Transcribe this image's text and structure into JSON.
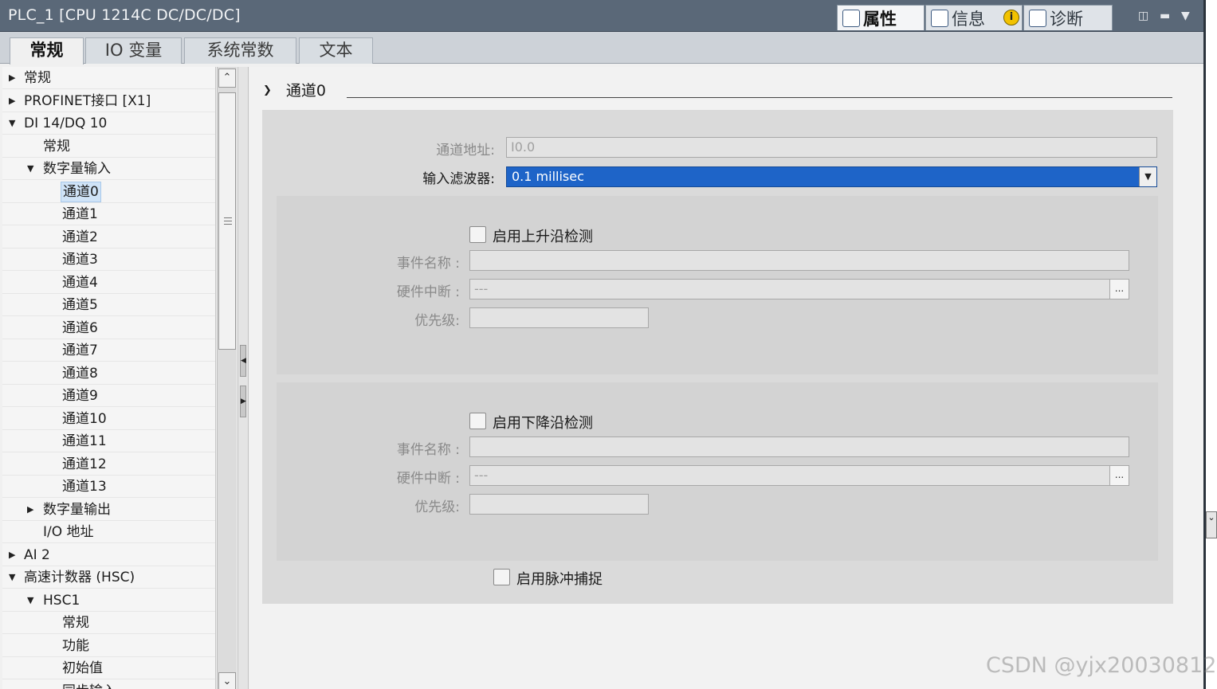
{
  "window": {
    "title": "PLC_1 [CPU 1214C DC/DC/DC]"
  },
  "inspector_tabs": [
    {
      "label": "属性",
      "icon": "properties-icon",
      "active": true
    },
    {
      "label": "信息",
      "icon": "info-icon",
      "badge": "i"
    },
    {
      "label": "诊断",
      "icon": "diagnostics-icon"
    }
  ],
  "subtabs": [
    "常规",
    "IO 变量",
    "系统常数",
    "文本"
  ],
  "tree": [
    {
      "label": "常规",
      "level": 0,
      "expander": "collapsed"
    },
    {
      "label": "PROFINET接口 [X1]",
      "level": 0,
      "expander": "collapsed"
    },
    {
      "label": "DI 14/DQ 10",
      "level": 0,
      "expander": "expanded"
    },
    {
      "label": "常规",
      "level": 1,
      "expander": "none"
    },
    {
      "label": "数字量输入",
      "level": 1,
      "expander": "expanded"
    },
    {
      "label": "通道0",
      "level": 2,
      "expander": "none",
      "selected": true
    },
    {
      "label": "通道1",
      "level": 2,
      "expander": "none"
    },
    {
      "label": "通道2",
      "level": 2,
      "expander": "none"
    },
    {
      "label": "通道3",
      "level": 2,
      "expander": "none"
    },
    {
      "label": "通道4",
      "level": 2,
      "expander": "none"
    },
    {
      "label": "通道5",
      "level": 2,
      "expander": "none"
    },
    {
      "label": "通道6",
      "level": 2,
      "expander": "none"
    },
    {
      "label": "通道7",
      "level": 2,
      "expander": "none"
    },
    {
      "label": "通道8",
      "level": 2,
      "expander": "none"
    },
    {
      "label": "通道9",
      "level": 2,
      "expander": "none"
    },
    {
      "label": "通道10",
      "level": 2,
      "expander": "none"
    },
    {
      "label": "通道11",
      "level": 2,
      "expander": "none"
    },
    {
      "label": "通道12",
      "level": 2,
      "expander": "none"
    },
    {
      "label": "通道13",
      "level": 2,
      "expander": "none"
    },
    {
      "label": "数字量输出",
      "level": 1,
      "expander": "collapsed"
    },
    {
      "label": "I/O 地址",
      "level": 1,
      "expander": "none"
    },
    {
      "label": "AI 2",
      "level": 0,
      "expander": "collapsed"
    },
    {
      "label": "高速计数器 (HSC)",
      "level": 0,
      "expander": "expanded"
    },
    {
      "label": "HSC1",
      "level": 1,
      "expander": "expanded"
    },
    {
      "label": "常规",
      "level": 2,
      "expander": "none"
    },
    {
      "label": "功能",
      "level": 2,
      "expander": "none"
    },
    {
      "label": "初始值",
      "level": 2,
      "expander": "none"
    },
    {
      "label": "同步输入",
      "level": 2,
      "expander": "none"
    }
  ],
  "section": {
    "title": "通道0",
    "channel_address_label": "通道地址:",
    "channel_address_value": "I0.0",
    "input_filter_label": "输入滤波器:",
    "input_filter_value": "0.1 millisec",
    "rising": {
      "checkbox_label": "启用上升沿检测",
      "event_name_label": "事件名称 :",
      "event_name_value": "",
      "hw_interrupt_label": "硬件中断 :",
      "hw_interrupt_value": "---",
      "priority_label": "优先级:",
      "priority_value": "",
      "checked": false
    },
    "falling": {
      "checkbox_label": "启用下降沿检测",
      "event_name_label": "事件名称 :",
      "event_name_value": "",
      "hw_interrupt_label": "硬件中断 :",
      "hw_interrupt_value": "---",
      "priority_label": "优先级:",
      "priority_value": "",
      "checked": false
    },
    "pulse_catch_label": "启用脉冲捕捉",
    "pulse_catch_checked": false,
    "browse_label": "..."
  },
  "watermark": "CSDN @yjx20030812",
  "colors": {
    "titlebar": "#5a6878",
    "selection": "#1e64c8",
    "panel": "#dadada"
  }
}
